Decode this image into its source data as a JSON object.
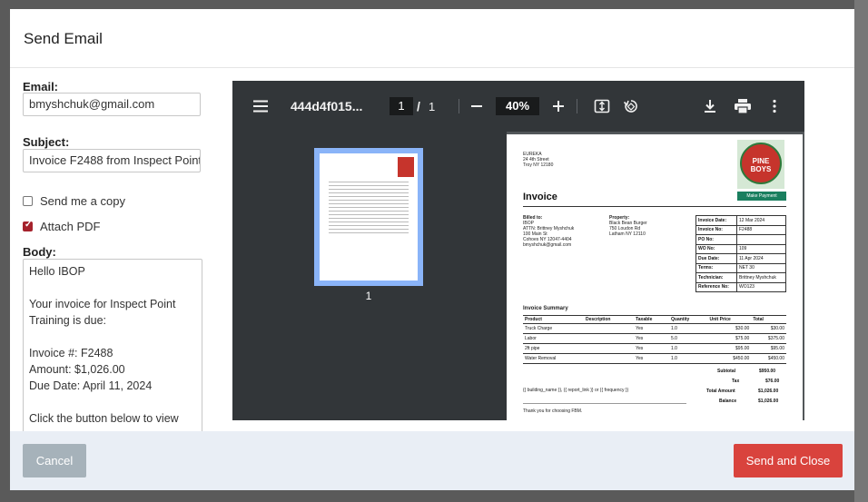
{
  "modal": {
    "title": "Send Email"
  },
  "form": {
    "email_label": "Email:",
    "email_value": "bmyshchuk@gmail.com",
    "subject_label": "Subject:",
    "subject_value": "Invoice F2488 from Inspect Point",
    "send_copy_label": "Send me a copy",
    "send_copy_checked": false,
    "attach_pdf_label": "Attach PDF",
    "attach_pdf_checked": true,
    "body_label": "Body:",
    "body_lines": [
      "Hello IBOP",
      "",
      "Your invoice for Inspect Point",
      "Training  is due:",
      "",
      "Invoice #: F2488",
      "Amount: $1,026.00",
      "Due Date: April 11, 2024",
      "",
      "Click the button below to view"
    ]
  },
  "viewer": {
    "filename": "444d4f015...",
    "page_current": "1",
    "page_separator": "/",
    "page_total": "1",
    "zoom": "40%",
    "thumbnail_label": "1",
    "icons": [
      "menu-icon",
      "zoom-out-icon",
      "zoom-in-icon",
      "fit-page-icon",
      "rotate-icon",
      "download-icon",
      "print-icon",
      "more-vert-icon"
    ]
  },
  "invoice": {
    "company_lines": [
      "EUREKA",
      "24 4th Street",
      "Troy NY  12180"
    ],
    "logo_text": "PINE BOYS",
    "make_payment": "Make Payment",
    "title": "Invoice",
    "billed_to_label": "Billed to:",
    "billed_to_lines": [
      "IBOP",
      "ATTN: Brittney Myshchuk",
      "100 Main St",
      "Cohoes NY  12047-4404",
      "bmyshchuk@gmail.com"
    ],
    "property_label": "Property:",
    "property_lines": [
      "Black Bean Burger",
      "750 Loudon Rd",
      "Latham NY  12110"
    ],
    "info": [
      {
        "k": "Invoice Date:",
        "v": "12 Mar 2024"
      },
      {
        "k": "Invoice No:",
        "v": "F2488"
      },
      {
        "k": "PO No:",
        "v": ""
      },
      {
        "k": "WO No:",
        "v": "109"
      },
      {
        "k": "Due Date:",
        "v": "11 Apr 2024"
      },
      {
        "k": "Terms:",
        "v": "NET 30"
      },
      {
        "k": "Technician:",
        "v": "Brittney Myshchuk"
      },
      {
        "k": "Reference No:",
        "v": "WO123"
      }
    ],
    "summary_title": "Invoice Summary",
    "columns": [
      "Product",
      "Description",
      "Taxable",
      "Quantity",
      "Unit Price",
      "Total"
    ],
    "rows": [
      [
        "Truck Charge",
        "",
        "Yes",
        "1.0",
        "$30.00",
        "$30.00"
      ],
      [
        "Labor",
        "",
        "Yes",
        "5.0",
        "$75.00",
        "$375.00"
      ],
      [
        "2ft pipe",
        "",
        "Yes",
        "1.0",
        "$95.00",
        "$95.00"
      ],
      [
        "Water Removal",
        "",
        "Yes",
        "1.0",
        "$450.00",
        "$450.00"
      ]
    ],
    "subtotal_label": "Subtotal",
    "subtotal": "$950.00",
    "tax_label": "Tax",
    "tax": "$76.00",
    "total_label": "Total Amount",
    "total": "$1,026.00",
    "balance_label": "Balance",
    "balance": "$1,026.00",
    "template_line": "{{ building_name }}, {{ report_link }} or {{ frequency }}",
    "thanks": "Thank you for choosing FBM."
  },
  "footer": {
    "cancel": "Cancel",
    "send": "Send and Close"
  },
  "colors": {
    "send_button": "#d9433d",
    "cancel_button": "#a6b2ba",
    "viewer_toolbar": "#323639"
  }
}
